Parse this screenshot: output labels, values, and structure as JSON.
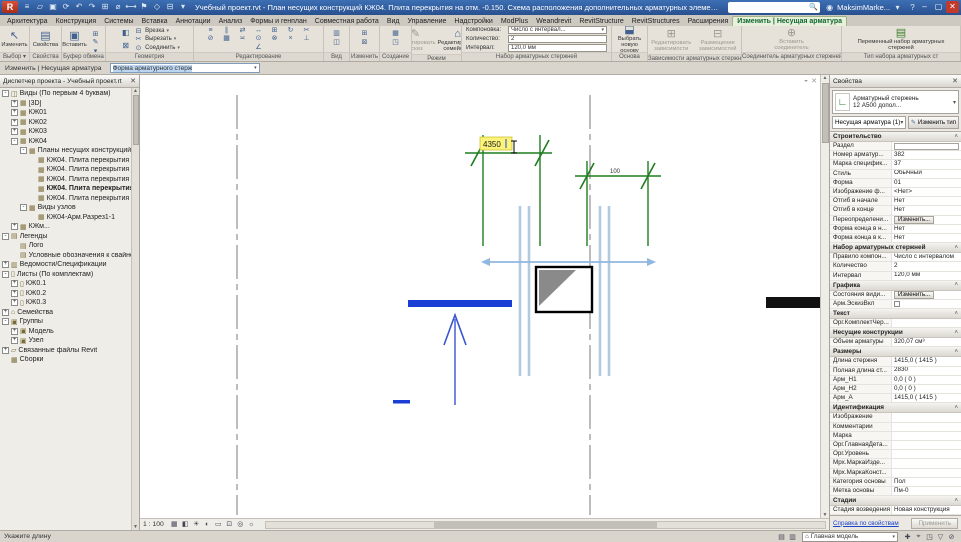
{
  "titlebar": {
    "product_initial": "R",
    "qat_icons": [
      {
        "n": "app-menu-icon",
        "g": "≡"
      },
      {
        "n": "open-icon",
        "g": "▱"
      },
      {
        "n": "save-icon",
        "g": "▣"
      },
      {
        "n": "sync-icon",
        "g": "⟳"
      },
      {
        "n": "undo-icon",
        "g": "↶"
      },
      {
        "n": "redo-icon",
        "g": "↷"
      },
      {
        "n": "print-icon",
        "g": "⊞"
      },
      {
        "n": "measure-icon",
        "g": "⌀"
      },
      {
        "n": "dimension-icon",
        "g": "⟷"
      },
      {
        "n": "tag-icon",
        "g": "⚑"
      },
      {
        "n": "3d-view-icon",
        "g": "◇"
      },
      {
        "n": "section-icon",
        "g": "⊟"
      },
      {
        "n": "qat-more-icon",
        "g": "▾"
      }
    ],
    "title": "Учебный проект.rvt - План несущих конструкций КЖ04. Плита перекрытия на отм. -0.150. Схема расположения дополнительных арматурных элементов",
    "search_placeholder": "",
    "user": "MaksimMarke...",
    "help": "?",
    "win_min": "–",
    "win_max": "▢",
    "win_close": "✕"
  },
  "tabs": [
    {
      "label": "Архитектура"
    },
    {
      "label": "Конструкция"
    },
    {
      "label": "Системы"
    },
    {
      "label": "Вставка"
    },
    {
      "label": "Аннотации"
    },
    {
      "label": "Анализ"
    },
    {
      "label": "Формы и генплан"
    },
    {
      "label": "Совместная работа"
    },
    {
      "label": "Вид"
    },
    {
      "label": "Управление"
    },
    {
      "label": "Надстройки"
    },
    {
      "label": "ModPlus"
    },
    {
      "label": "Weandrevit"
    },
    {
      "label": "RevitStructure"
    },
    {
      "label": "RevitStructures"
    },
    {
      "label": "Расширения"
    },
    {
      "label": "Изменить | Несущая арматура",
      "active": true
    }
  ],
  "ribbon": {
    "groups": {
      "select": {
        "label": "Выбор ▾",
        "button": "Изменить",
        "icon": "↖"
      },
      "properties": {
        "label": "Свойства",
        "button": "Свойства",
        "icon": "▤"
      },
      "clipboard": {
        "label": "Буфер обмена",
        "button": "Вставить",
        "icon": "▣",
        "icons": [
          {
            "n": "cut-icon",
            "g": "✂"
          },
          {
            "n": "copy-icon",
            "g": "⊞"
          },
          {
            "n": "match-type-icon",
            "g": "✎"
          },
          {
            "n": "paste-options-icon",
            "g": "▾"
          }
        ]
      },
      "geometry": {
        "label": "Геометрия",
        "col_icons": [
          {
            "n": "paint-icon",
            "g": "◧"
          },
          {
            "n": "demolish-icon",
            "g": "⊠"
          }
        ],
        "rows": [
          {
            "n": "cope-item",
            "label": "Врезка",
            "g": "⊟",
            "arrow": "▾"
          },
          {
            "n": "cut-geometry-item",
            "label": "Вырезать",
            "g": "✂",
            "arrow": "▾"
          },
          {
            "n": "join-item",
            "label": "Соединить",
            "g": "⊙",
            "arrow": "▾"
          }
        ]
      },
      "edit": {
        "label": "Редактирование",
        "icons": [
          {
            "n": "align-icon",
            "g": "≡"
          },
          {
            "n": "offset-icon",
            "g": "∥"
          },
          {
            "n": "mirror-icon",
            "g": "⇄"
          },
          {
            "n": "move-icon",
            "g": "↔"
          },
          {
            "n": "copy-icon",
            "g": "⊞"
          },
          {
            "n": "rotate-icon",
            "g": "↻"
          },
          {
            "n": "trim-icon",
            "g": "✂"
          },
          {
            "n": "split-icon",
            "g": "⊘"
          },
          {
            "n": "array-icon",
            "g": "▦"
          },
          {
            "n": "scale-icon",
            "g": "≍"
          },
          {
            "n": "pin-icon",
            "g": "⊙"
          },
          {
            "n": "unpin-icon",
            "g": "⊗"
          },
          {
            "n": "delete-icon",
            "g": "×"
          },
          {
            "n": "join-lines-icon",
            "g": "⊥"
          },
          {
            "n": "angle-icon",
            "g": "∠"
          }
        ]
      },
      "view": {
        "label": "Вид",
        "icons": [
          {
            "n": "thin-lines-icon",
            "g": "▥"
          },
          {
            "n": "hidden-lines-icon",
            "g": "◫"
          }
        ]
      },
      "modify2": {
        "label": "Изменить",
        "icons": [
          {
            "n": "edit-wall-icon",
            "g": "⊞"
          },
          {
            "n": "edit-profile-icon",
            "g": "⊠"
          }
        ]
      },
      "create": {
        "label": "Создание",
        "icons": [
          {
            "n": "create-group-icon",
            "g": "▦"
          },
          {
            "n": "create-similar-icon",
            "g": "◳"
          }
        ]
      },
      "mode": {
        "label": "Режим",
        "buttons": [
          {
            "label": "Редактировать эскиз",
            "icon": "✎",
            "disabled": true,
            "n": "edit-sketch-button"
          },
          {
            "label": "Редактировать семейство",
            "icon": "⌂",
            "disabled": false,
            "n": "edit-family-button"
          }
        ]
      },
      "rebar_set": {
        "label": "Набор арматурных стержней",
        "fields": [
          {
            "k": "Компоновка:",
            "v": "Число с интервал...",
            "arrow": "▾",
            "n": "layout-rule-field"
          },
          {
            "k": "Количество:",
            "v": "2",
            "arrow": "",
            "n": "quantity-field"
          },
          {
            "k": "Интервал:",
            "v": "120,0 мм",
            "arrow": "",
            "n": "spacing-field"
          }
        ]
      },
      "host": {
        "label": "Основа",
        "button": "Выбрать новую основу",
        "icon": "⬓"
      },
      "constraints": {
        "label": "Зависимости арматурных стержней",
        "buttons": [
          {
            "label": "Редактировать зависимости",
            "icon": "⊞",
            "disabled": true,
            "n": "edit-constraints-button"
          },
          {
            "label": "Размещение зависимостей",
            "icon": "⊟",
            "disabled": true,
            "n": "constraint-placement-button"
          }
        ]
      },
      "coupler": {
        "label": "Соединитель арматурных стержней",
        "button": "Вставить соединитель",
        "icon": "⊕",
        "disabled": true
      },
      "set_type": {
        "label": "Тип набора арматурных ст",
        "button": "Переменный набор арматурных стержней",
        "icon": "▤"
      }
    }
  },
  "optionsbar": {
    "mode_label": "Изменить | Несущая арматура",
    "shape_combo": "Форма арматурного стерж",
    "combo_arrow": "▾"
  },
  "browser": {
    "title": "Диспетчер проекта - Учебный проект.rt",
    "close": "✕",
    "tree": [
      {
        "t": "Виды (По первым 4 буквам)",
        "l": 0,
        "e": "-",
        "ic": "◫"
      },
      {
        "t": "[3D]",
        "l": 1,
        "e": "+",
        "ic": "▦"
      },
      {
        "t": "КЖ01",
        "l": 1,
        "e": "+",
        "ic": "▦"
      },
      {
        "t": "КЖ02",
        "l": 1,
        "e": "+",
        "ic": "▦"
      },
      {
        "t": "КЖ03",
        "l": 1,
        "e": "+",
        "ic": "▦"
      },
      {
        "t": "КЖ04",
        "l": 1,
        "e": "-",
        "ic": "▦"
      },
      {
        "t": "Планы несущих конструкций",
        "l": 2,
        "e": "-",
        "ic": "▦"
      },
      {
        "t": "КЖ04. Плита перекрытия на отм...",
        "l": 3,
        "e": "",
        "ic": "▦"
      },
      {
        "t": "КЖ04. Плита перекрытия на отм...",
        "l": 3,
        "e": "",
        "ic": "▦"
      },
      {
        "t": "КЖ04. Плита перекрытия на отм...",
        "l": 3,
        "e": "",
        "ic": "▦"
      },
      {
        "t": "КЖ04. Плита перекрытия на отм",
        "l": 3,
        "e": "",
        "ic": "▦",
        "b": true
      },
      {
        "t": "КЖ04. Плита перекрытия на отм...",
        "l": 3,
        "e": "",
        "ic": "▦"
      },
      {
        "t": "Виды узлов",
        "l": 2,
        "e": "-",
        "ic": "▦"
      },
      {
        "t": "КЖ04-Арм.Разрез1-1",
        "l": 3,
        "e": "",
        "ic": "▦"
      },
      {
        "t": "КЖм...",
        "l": 1,
        "e": "+",
        "ic": "▦"
      },
      {
        "t": "Легенды",
        "l": 0,
        "e": "-",
        "ic": "▤"
      },
      {
        "t": "Лого",
        "l": 1,
        "e": "",
        "ic": "▤"
      },
      {
        "t": "Условные обозначения к свайному пол...",
        "l": 1,
        "e": "",
        "ic": "▤"
      },
      {
        "t": "Ведомости/Спецификации",
        "l": 0,
        "e": "+",
        "ic": "▥"
      },
      {
        "t": "Листы (По комплектам)",
        "l": 0,
        "e": "-",
        "ic": "▯"
      },
      {
        "t": "КЖ0.1",
        "l": 1,
        "e": "+",
        "ic": "▯"
      },
      {
        "t": "КЖ0.2",
        "l": 1,
        "e": "+",
        "ic": "▯"
      },
      {
        "t": "КЖ0.3",
        "l": 1,
        "e": "+",
        "ic": "▯"
      },
      {
        "t": "Семейства",
        "l": 0,
        "e": "+",
        "ic": "⌂"
      },
      {
        "t": "Группы",
        "l": 0,
        "e": "-",
        "ic": "▣"
      },
      {
        "t": "Модель",
        "l": 1,
        "e": "+",
        "ic": "▣"
      },
      {
        "t": "Узел",
        "l": 1,
        "e": "+",
        "ic": "▣"
      },
      {
        "t": "Связанные файлы Revit",
        "l": 0,
        "e": "+",
        "ic": "▱"
      },
      {
        "t": "Сборки",
        "l": 0,
        "e": "",
        "ic": "▦"
      }
    ]
  },
  "canvas": {
    "edit_dim_value": "4350",
    "dim_label": "100",
    "scale": "1 : 100",
    "view_icons": [
      {
        "n": "detail-level-icon",
        "g": "▦"
      },
      {
        "n": "visual-style-icon",
        "g": "◧"
      },
      {
        "n": "sun-path-icon",
        "g": "☀"
      },
      {
        "n": "shadows-icon",
        "g": "◐"
      },
      {
        "n": "crop-view-icon",
        "g": "▭"
      },
      {
        "n": "show-crop-icon",
        "g": "⊡"
      },
      {
        "n": "temporary-hide-icon",
        "g": "◎"
      },
      {
        "n": "reveal-hidden-icon",
        "g": "☼"
      }
    ],
    "nav_icons": [
      {
        "n": "navigation-wheel-icon",
        "g": "◒"
      },
      {
        "n": "close-view-icon",
        "g": "✕"
      }
    ]
  },
  "properties": {
    "panel_title": "Свойства",
    "close": "✕",
    "type_name1": "Арматурный стержень",
    "type_name2": "12 А500 допол...",
    "selector": "Несущая арматура (1)",
    "edit_type_label": "Изменить тип",
    "sections": [
      {
        "h": "Строительство",
        "rows": [
          {
            "k": "Раздел",
            "v": "",
            "input": true
          },
          {
            "k": "Номер арматур...",
            "v": "382"
          },
          {
            "k": "Марка специфик...",
            "v": "37"
          },
          {
            "k": "Стиль",
            "v": "Обычный"
          },
          {
            "k": "Форма",
            "v": "01"
          },
          {
            "k": "Изображение ф...",
            "v": "<Нет>"
          },
          {
            "k": "Отгиб в начале",
            "v": "Нет"
          },
          {
            "k": "Отгиб в конце",
            "v": "Нет"
          },
          {
            "k": "Переопределени...",
            "v": "Изменить...",
            "btn": true
          },
          {
            "k": "Форма конца в н...",
            "v": "Нет"
          },
          {
            "k": "Форма конца в к...",
            "v": "Нет"
          }
        ]
      },
      {
        "h": "Набор арматурных стержней",
        "rows": [
          {
            "k": "Правило компон...",
            "v": "Число с интервалом"
          },
          {
            "k": "Количество",
            "v": "2"
          },
          {
            "k": "Интервал",
            "v": "120,0 мм"
          }
        ]
      },
      {
        "h": "Графика",
        "rows": [
          {
            "k": "Состояния види...",
            "v": "Изменить...",
            "btn": true
          },
          {
            "k": "Арм.ЭскизВкл",
            "v": "",
            "check": true
          }
        ]
      },
      {
        "h": "Текст",
        "rows": [
          {
            "k": "Орг.КомплектЧер...",
            "v": ""
          }
        ]
      },
      {
        "h": "Несущие конструкции",
        "rows": [
          {
            "k": "Объем арматуры",
            "v": "320,07 см³"
          }
        ]
      },
      {
        "h": "Размеры",
        "rows": [
          {
            "k": "Длина стержня",
            "v": "1415,0 ( 1415 )"
          },
          {
            "k": "Полная длина ст...",
            "v": "2830"
          },
          {
            "k": "Арм_H1",
            "v": "0,0 ( 0 )"
          },
          {
            "k": "Арм_H2",
            "v": "0,0 ( 0 )"
          },
          {
            "k": "Арм_A",
            "v": "1415,0 ( 1415 )"
          }
        ]
      },
      {
        "h": "Идентификация",
        "rows": [
          {
            "k": "Изображение",
            "v": ""
          },
          {
            "k": "Комментарии",
            "v": ""
          },
          {
            "k": "Марка",
            "v": ""
          },
          {
            "k": "Орг.ГлавнаяДета...",
            "v": ""
          },
          {
            "k": "Орг.Уровень",
            "v": ""
          },
          {
            "k": "Мрх.МаркаИзде...",
            "v": ""
          },
          {
            "k": "Мрх.МаркаКонст...",
            "v": ""
          },
          {
            "k": "Категория основы",
            "v": "Пол"
          },
          {
            "k": "Метка основы",
            "v": "Пм-0"
          }
        ]
      },
      {
        "h": "Стадии",
        "rows": [
          {
            "k": "Стадия возведения",
            "v": "Новая конструкция"
          }
        ]
      }
    ],
    "help_link": "Справка по свойствам",
    "apply_label": "Применить"
  },
  "statusbar": {
    "hint": "Укажите длину",
    "model_combo": "Главная модель",
    "model_icon": "⌂",
    "left_icons": [
      {
        "n": "worksets-icon",
        "g": "▤"
      },
      {
        "n": "design-options-icon",
        "g": "▥"
      }
    ],
    "right_icons": [
      {
        "n": "select-link-icon",
        "g": "✚"
      },
      {
        "n": "select-pinned-icon",
        "g": "⌖"
      },
      {
        "n": "select-by-face-icon",
        "g": "◳"
      },
      {
        "n": "filter-icon",
        "g": "▽"
      },
      {
        "n": "exclude-options-icon",
        "g": "⊘"
      }
    ]
  }
}
